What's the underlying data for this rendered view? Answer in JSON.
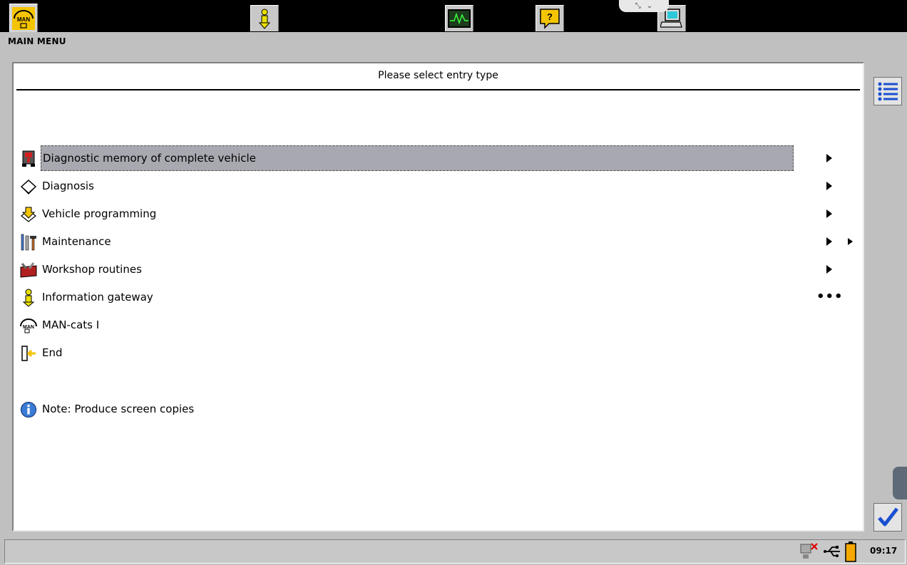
{
  "toolbar": {
    "buttons": [
      {
        "name": "man-logo",
        "label": "MAN"
      },
      {
        "name": "information"
      },
      {
        "name": "measurement"
      },
      {
        "name": "help"
      },
      {
        "name": "computer"
      }
    ]
  },
  "header": {
    "section_label": "MAIN MENU"
  },
  "panel": {
    "title": "Please select entry type",
    "items": [
      {
        "label": "Diagnostic memory of complete vehicle",
        "icon": "truck-fault-icon",
        "indicator": "arrow",
        "selected": true
      },
      {
        "label": "Diagnosis",
        "icon": "diagnosis-book-icon",
        "indicator": "arrow"
      },
      {
        "label": "Vehicle programming",
        "icon": "programming-download-icon",
        "indicator": "arrow"
      },
      {
        "label": "Maintenance",
        "icon": "maintenance-tools-icon",
        "indicator": "double-arrow"
      },
      {
        "label": "Workshop routines",
        "icon": "workshop-toolbox-icon",
        "indicator": "arrow"
      },
      {
        "label": "Information gateway",
        "icon": "info-person-icon",
        "indicator": "ellipsis",
        "indicator_text": "•••"
      },
      {
        "label": "MAN-cats I",
        "icon": "man-cats-icon",
        "indicator": "none"
      },
      {
        "label": "End",
        "icon": "exit-door-icon",
        "indicator": "none"
      }
    ],
    "note": {
      "label": "Note: Produce screen copies",
      "icon": "info-circle-icon"
    }
  },
  "statusbar": {
    "time": "09:17"
  },
  "colors": {
    "selection_bg": "#a8a8b0",
    "accent_blue": "#1a4fd0",
    "man_yellow": "#f5c400"
  }
}
